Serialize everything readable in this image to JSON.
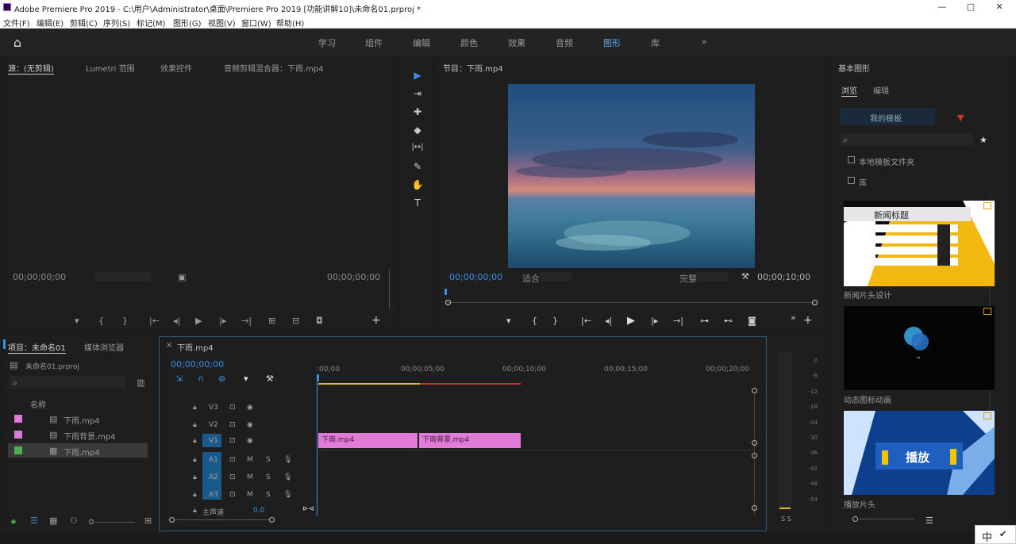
{
  "window": {
    "title": "Adobe Premiere Pro 2019 - C:\\用户\\Administrator\\桌面\\Premiere Pro 2019 [功能讲解10]\\未命名01.prproj *",
    "minimize": "—",
    "maximize": "▢",
    "close": "✕"
  },
  "menu": [
    "文件(F)",
    "编辑(E)",
    "剪辑(C)",
    "序列(S)",
    "标记(M)",
    "图形(G)",
    "视图(V)",
    "窗口(W)",
    "帮助(H)"
  ],
  "workspaces": [
    "学习",
    "组件",
    "编辑",
    "颜色",
    "效果",
    "音频",
    "图形",
    "库",
    "»"
  ],
  "source_panel": {
    "tabs": [
      "源：(无剪辑)",
      "Lumetri 范围",
      "效果控件",
      "音频剪辑混合器：下雨.mp4"
    ],
    "tc_left": "00;00;00;00",
    "tc_right": "00;00;00;00"
  },
  "program_panel": {
    "tab": "节目：下雨.mp4",
    "tc_current": "00;00;00;00",
    "fit": "适合",
    "quality": "完整",
    "tc_duration": "00;00;10;00"
  },
  "tools": [
    "▶",
    "⇥",
    "✚",
    "◆",
    "|↔|",
    "✎",
    "✋",
    "T"
  ],
  "project_panel": {
    "tabs": [
      "项目：未命名01",
      "媒体浏览器"
    ],
    "project_name": "未命名01.prproj",
    "search_placeholder": "",
    "column_name": "名称",
    "items": [
      {
        "name": "下雨.mp4",
        "color": "#e07ad8"
      },
      {
        "name": "下雨背景.mp4",
        "color": "#e07ad8"
      },
      {
        "name": "下雨.mp4",
        "color": "#4caf50"
      }
    ]
  },
  "timeline": {
    "tab": "下雨.mp4",
    "timecode": "00;00;00;00",
    "ruler": [
      ":00;00",
      "00;00;05;00",
      "00;00;10;00",
      "00;00;15;00",
      "00;00;20;00"
    ],
    "clips": [
      {
        "name": "下雨.mp4"
      },
      {
        "name": "下雨背景.mp4"
      }
    ],
    "master": "主声道",
    "master_value": "0.0",
    "track_labels": [
      "V3",
      "V2",
      "V1",
      "A1",
      "A2",
      "A3"
    ]
  },
  "meter_labels": [
    "0",
    "-6",
    "-12",
    "-18",
    "-24",
    "-30",
    "-36",
    "-42",
    "-48",
    "-54",
    "dB"
  ],
  "meter_sr": "S S",
  "essential_graphics": {
    "tab": "基本图形",
    "subtabs": [
      "浏览",
      "编辑"
    ],
    "dropdown": "我的模板",
    "search_placeholder": "",
    "checkbox1": "本地模板文件夹",
    "checkbox2": "库",
    "templates": [
      {
        "name": "新闻片头设计",
        "banner": "新闻标题"
      },
      {
        "name": "动态图标动画",
        "banner": ""
      },
      {
        "name": "播放片头",
        "banner": "播放"
      }
    ]
  },
  "ime": {
    "label": "中"
  },
  "colors": {
    "accent": "#3b8eea",
    "clip": "#e27ad8",
    "track_blue": "#1a5a8a",
    "work_yellow": "#d6c21a",
    "work_red": "#d0302a"
  }
}
